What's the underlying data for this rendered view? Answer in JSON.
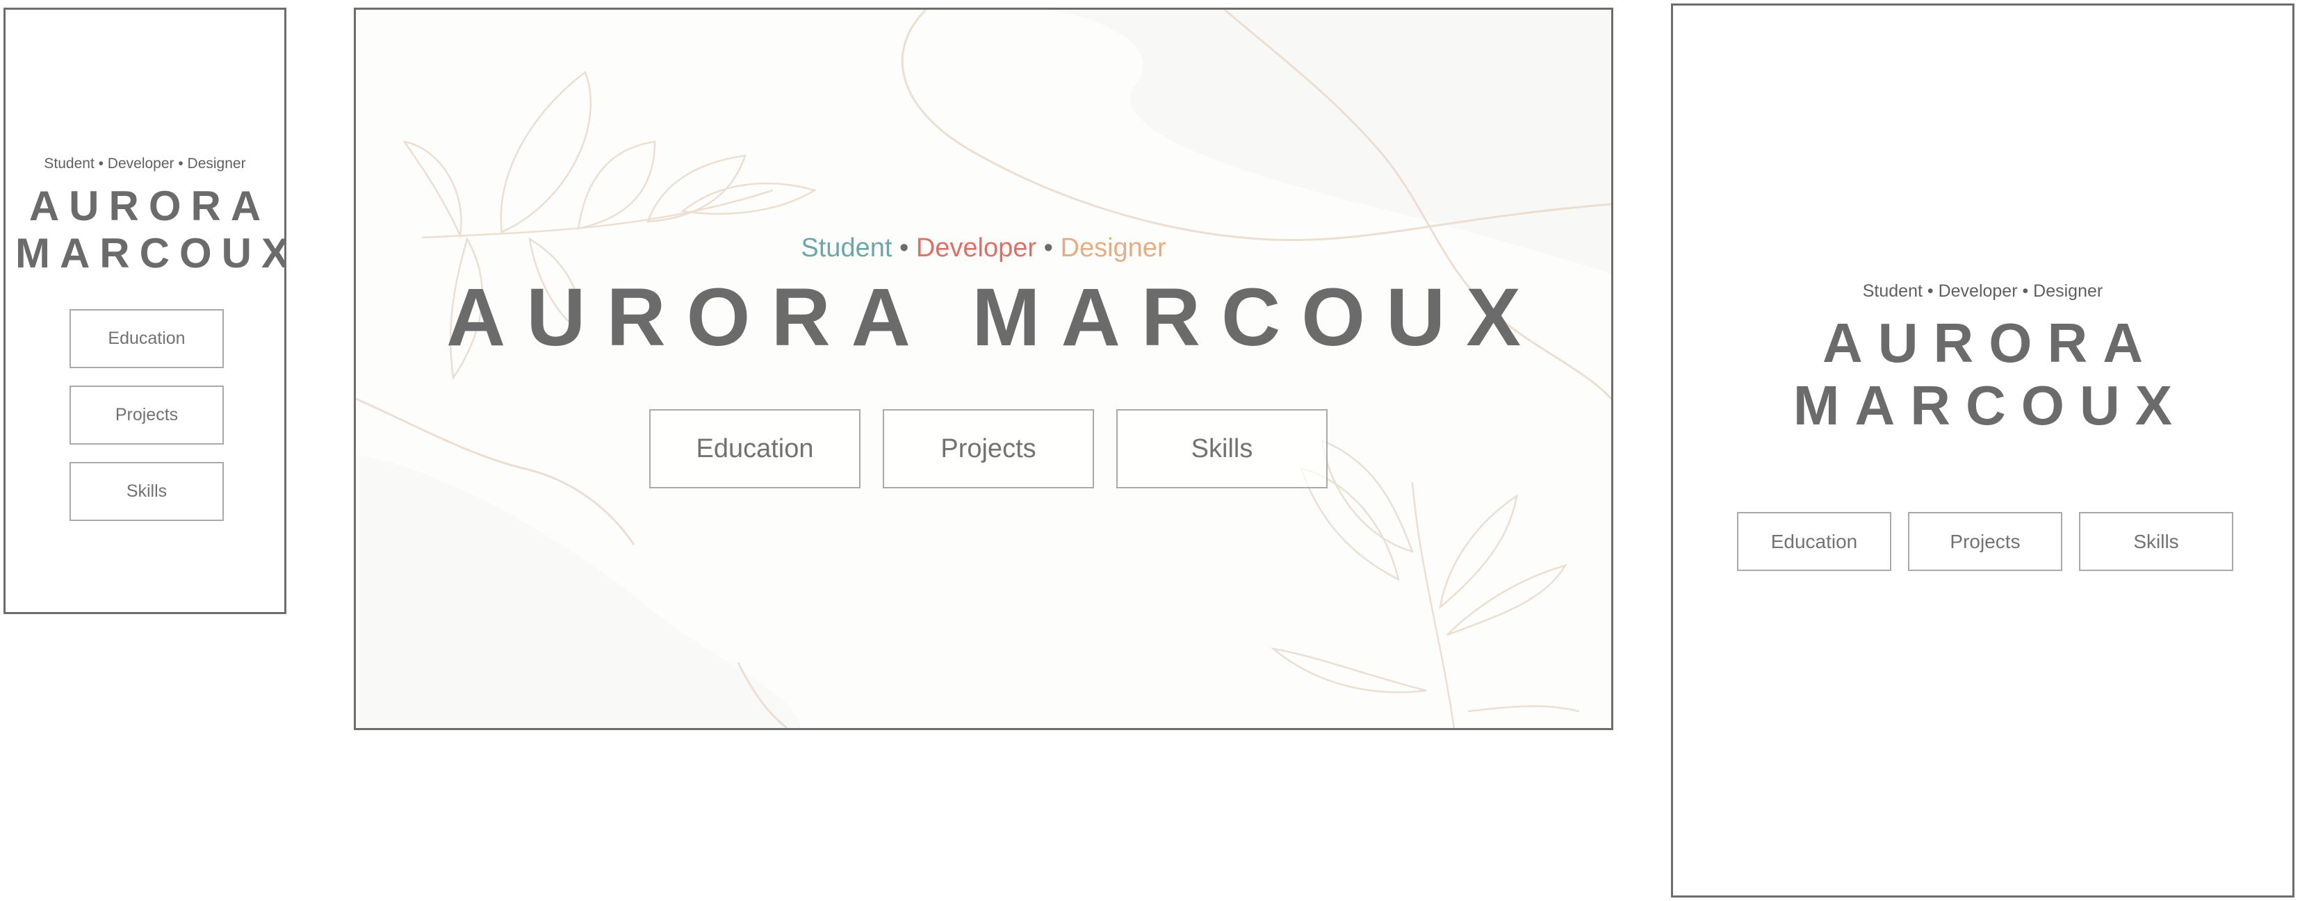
{
  "colors": {
    "frame_border": "#6d6d6d",
    "name_text": "#6b6b6b",
    "button_border": "#a9a9a9",
    "button_text": "#727272",
    "tagline_student": "#6aa7a8",
    "tagline_developer": "#df6f66",
    "tagline_designer": "#e3ad85",
    "leaf_stroke": "#ecdfd2"
  },
  "mobile": {
    "tagline": "Student • Developer • Designer",
    "name_line1": "AURORA",
    "name_line2": "MARCOUX",
    "buttons": [
      "Education",
      "Projects",
      "Skills"
    ]
  },
  "desktop": {
    "tagline": {
      "student": "Student",
      "separator": "•",
      "developer": "Developer",
      "designer": "Designer"
    },
    "name": "AURORA MARCOUX",
    "buttons": [
      "Education",
      "Projects",
      "Skills"
    ]
  },
  "tablet": {
    "tagline": "Student • Developer • Designer",
    "name_line1": "AURORA",
    "name_line2": "MARCOUX",
    "buttons": [
      "Education",
      "Projects",
      "Skills"
    ]
  }
}
